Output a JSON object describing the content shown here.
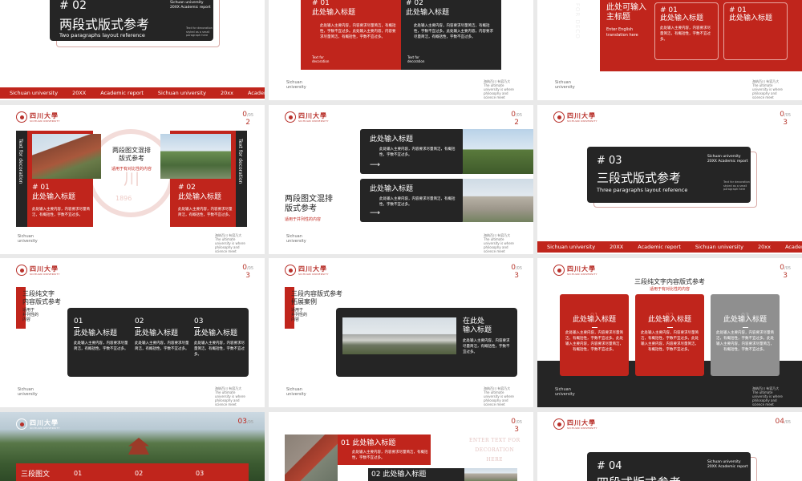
{
  "colors": {
    "accent": "#c0251c",
    "dark": "#252525",
    "grey": "#8f8f8f"
  },
  "common": {
    "logo_cn": "四川大學",
    "logo_en": "SICHUAN UNIVERSITY",
    "footer_left": "Sichuan\nuniversity",
    "footer_right": "海纳百川 有容乃大\nThe ultimate university is where\nphilosophy and science meet",
    "mini_caption": "Sichuan university\n20XX      Academic report",
    "mini_note": "Text for decoration,\nstyled as a small\nparagraph here"
  },
  "ribbon": [
    "Sichuan university",
    "20XX",
    "Academic report",
    "Sichuan university",
    "20xx",
    "Academic repo"
  ],
  "ribbon2": [
    "Sichuan university",
    "20XX",
    "Academic report",
    "Sichuan university",
    "20xx",
    "Academic repo"
  ],
  "s1": {
    "num": "# 02",
    "title": "两段式版式参考",
    "sub": "Two paragraphs layout reference",
    "note": "Text for decoration\nstyled as a small\nparagraph here"
  },
  "s2": {
    "left": {
      "num": "# 01",
      "title": "此处输入标题",
      "body": "此处输入主要内容，内容要求尽量简洁，有概括性，字数不宜过多。此处输入主要内容，内容要求尽量简洁，有概括性，字数不宜过多。",
      "deco": "Text for\ndecoration"
    },
    "right": {
      "num": "# 02",
      "title": "此处输入标题",
      "body": "此处输入主要内容，内容要求尽量简洁，有概括性，字数不宜过多。此处输入主要内容，内容要求尽量简洁，有概括性，字数不宜过多。",
      "deco": "Text for\ndecoration"
    }
  },
  "s3": {
    "vertical": "TEXT FOR DECO",
    "title": "此处可输入\n主标题",
    "en": "Enter English\ntranslation here",
    "cards": [
      {
        "num": "# 01",
        "title": "此处输入标题",
        "body": "此处输入主要内容，内容要求尽量简洁，有概括性，字数不宜过多。"
      },
      {
        "num": "# 01",
        "title": "此处输入标题",
        "body": "此处输入主要内容，内容要求尽量简洁，有概括性，字数不宜过多。"
      }
    ]
  },
  "s4": {
    "page": "0",
    "page_total": "/05",
    "page2": "2",
    "deco_left": "Text for decoration",
    "deco_right": "Text for decoration",
    "center_title": "两段图文混排\n版式参考",
    "center_sub": "适用于有对比性的内容",
    "seal_year": "1896",
    "left": {
      "num": "# 01",
      "title": "此处输入标题",
      "body": "此处输入主要内容，内容要求尽量简洁，有概括性，字数不宜过多。"
    },
    "right": {
      "num": "# 02",
      "title": "此处输入标题",
      "body": "此处输入主要内容，内容要求尽量简洁，有概括性，字数不宜过多。"
    }
  },
  "s5": {
    "page": "0",
    "page_total": "/05",
    "page2": "2",
    "title": "两段图文混排\n版式参考",
    "sub": "适用于并列性的内容",
    "rows": [
      {
        "title": "此处输入标题",
        "body": "此处输入主要内容，内容要求尽量简洁，有概括性，字数不宜过多。",
        "arrow": "⟶"
      },
      {
        "title": "此处输入标题",
        "body": "此处输入主要内容，内容要求尽量简洁，有概括性，字数不宜过多。",
        "arrow": "⟶"
      }
    ]
  },
  "s6": {
    "page": "0",
    "page_total": "/05",
    "page2": "3",
    "num": "# 03",
    "title": "三段式版式参考",
    "sub": "Three paragraphs layout reference",
    "note": "Text for decoration\nstyled as a small\nparagraph here"
  },
  "s7": {
    "page": "0",
    "page_total": "/05",
    "page2": "3",
    "title": "三段纯文字\n内容版式参考",
    "sub": "适用于\n并列性的\n内容",
    "cols": [
      {
        "num": "01",
        "title": "此处输入标题",
        "body": "此处输入主要内容，内容要求尽量简洁，有概括性，字数不宜过多。"
      },
      {
        "num": "02",
        "title": "此处输入标题",
        "body": "此处输入主要内容，内容要求尽量简洁，有概括性，字数不宜过多。"
      },
      {
        "num": "03",
        "title": "此处输入标题",
        "body": "此处输入主要内容，内容要求尽量简洁，有概括性，字数不宜过多。"
      }
    ]
  },
  "s8": {
    "page": "0",
    "page_total": "/05",
    "page2": "3",
    "title": "三段内容版式参考\n拓展案例",
    "sub": "适用于\n并列性的\n内容",
    "card_title": "在此处\n输入标题",
    "card_body": "此处输入主要内容，内容要求尽量简洁，有概括性，字数不宜过多。"
  },
  "s9": {
    "page": "0",
    "page_total": "/05",
    "page2": "3",
    "title": "三段纯文字内容版式参考",
    "sub": "适用于有对比性的内容",
    "cards": [
      {
        "num": "01",
        "title": "此处输入标题",
        "body": "此处输入主要内容，内容要求尽量简洁，有概括性，字数不宜过多。此处输入主要内容，内容要求尽量简洁，有概括性，字数不宜过多。"
      },
      {
        "num": "02",
        "title": "此处输入标题",
        "body": "此处输入主要内容，内容要求尽量简洁，有概括性，字数不宜过多。此处输入主要内容，内容要求尽量简洁，有概括性，字数不宜过多。"
      },
      {
        "num": "03",
        "title": "此处输入标题",
        "body": "此处输入主要内容，内容要求尽量简洁，有概括性，字数不宜过多。此处输入主要内容，内容要求尽量简洁，有概括性，字数不宜过多。"
      }
    ]
  },
  "s10": {
    "page": "03",
    "page_total": "/05",
    "title": "三段图文",
    "cols": [
      "01",
      "02",
      "03"
    ]
  },
  "s11": {
    "page": "0",
    "page_total": "/05",
    "page2": "3",
    "deco": "ENTER TEXT FOR\nDECORATION\nHERE",
    "r1": {
      "label": "01  此处输入标题",
      "body": "此处输入主要内容，内容要求尽量简洁，有概括性，字数不宜过多。"
    },
    "r2": {
      "label": "02  此处输入标题"
    }
  },
  "s12": {
    "page": "04",
    "page_total": "/05",
    "num": "# 04",
    "title": "四段式版式参考",
    "caption": "Sichuan university\n20XX      Academic report"
  }
}
